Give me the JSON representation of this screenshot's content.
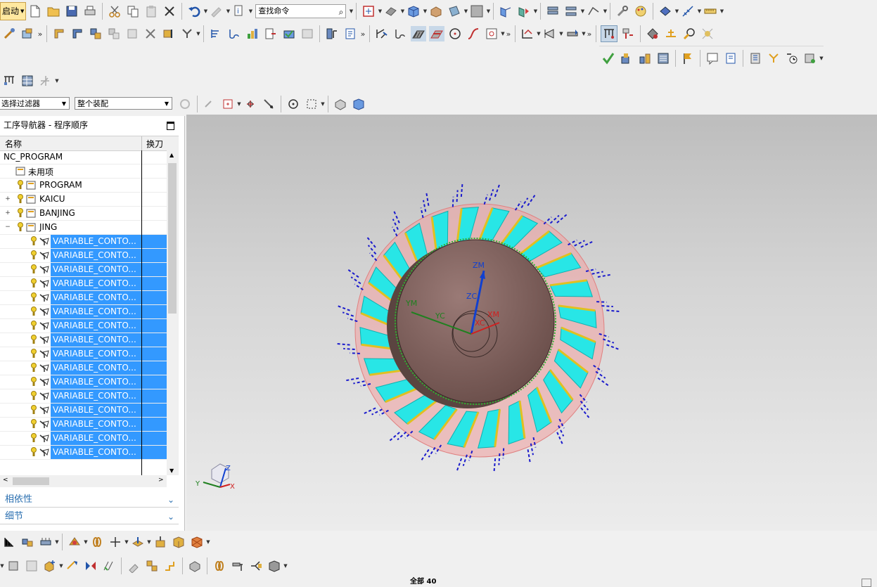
{
  "toolbar": {
    "start_label": "启动",
    "search_placeholder": "查找命令",
    "row1_icons": [
      "new-file-icon",
      "open-folder-icon",
      "save-icon",
      "print-icon",
      "cut-icon",
      "copy-icon",
      "paste-icon",
      "delete-icon",
      "undo-icon",
      "repeat-command-icon",
      "info-icon",
      "fit-view-icon",
      "shade-icon",
      "solid-cube-icon",
      "section-view-icon",
      "layer-icon",
      "background-icon",
      "feature-icon",
      "component-icon",
      "assembly-icon",
      "explode-icon",
      "constraint-icon",
      "measure-icon",
      "ruler-icon"
    ],
    "row2_icons": [
      "create-program-icon",
      "create-tool-icon",
      "create-geometry-icon",
      "create-method-icon",
      "create-operation-icon",
      "generate-toolpath-icon",
      "replay-toolpath-icon",
      "verify-toolpath-icon",
      "post-process-icon",
      "shop-doc-icon",
      "list-toolpath-icon",
      "machine-tool-icon",
      "cutter-icon",
      "ipw-icon",
      "check-icon",
      "shading-icon",
      "display-icon",
      "circle-icon",
      "curve-icon",
      "point-icon",
      "feature-group-icon",
      "operation-nav-icon",
      "tool-nav-icon",
      "wizard-icon",
      "zoom-icon"
    ]
  },
  "filter_bar": {
    "selection_filter": "选择过滤器",
    "assembly_scope": "整个装配"
  },
  "navigator": {
    "title": "工序导航器 - 程序顺序",
    "columns": {
      "name": "名称",
      "toolchange": "换刀"
    },
    "root": "NC_PROGRAM",
    "items": [
      {
        "label": "未用项"
      },
      {
        "label": "PROGRAM"
      },
      {
        "label": "KAICU"
      },
      {
        "label": "BANJING"
      },
      {
        "label": "JING"
      }
    ],
    "operations": [
      "VARIABLE_CONTO...",
      "VARIABLE_CONTO...",
      "VARIABLE_CONTO...",
      "VARIABLE_CONTO...",
      "VARIABLE_CONTO...",
      "VARIABLE_CONTO...",
      "VARIABLE_CONTO...",
      "VARIABLE_CONTO...",
      "VARIABLE_CONTO...",
      "VARIABLE_CONTO...",
      "VARIABLE_CONTO...",
      "VARIABLE_CONTO...",
      "VARIABLE_CONTO...",
      "VARIABLE_CONTO...",
      "VARIABLE_CONTO...",
      "VARIABLE_CONTO..."
    ],
    "panels": {
      "dependencies": "相依性",
      "details": "细节"
    }
  },
  "viewport": {
    "axes": {
      "zm": "ZM",
      "zc": "ZC",
      "ym": "YM",
      "yc": "YC",
      "xm": "XM",
      "xc": "XC"
    },
    "triad": {
      "z": "Z",
      "y": "Y",
      "x": "X"
    },
    "colors": {
      "blade": "#28e6e6",
      "hub": "#8a6a66",
      "toolpath": "#1a1acc",
      "stock": "#f2a0a0",
      "csys_z": "#1040d0",
      "csys_y": "#208020",
      "csys_x": "#d02020"
    }
  },
  "status": {
    "text": "全部 40"
  }
}
